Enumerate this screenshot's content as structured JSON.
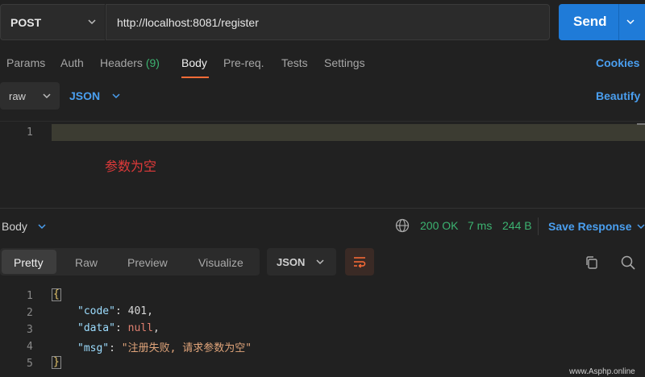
{
  "request": {
    "method": "POST",
    "url": "http://localhost:8081/register",
    "send_label": "Send"
  },
  "request_tabs": {
    "params": "Params",
    "auth": "Auth",
    "headers": "Headers",
    "headers_count": "(9)",
    "body": "Body",
    "prereq": "Pre-req.",
    "tests": "Tests",
    "settings": "Settings",
    "active": "Body",
    "cookies": "Cookies"
  },
  "body_options": {
    "mode": "raw",
    "language": "JSON",
    "beautify": "Beautify"
  },
  "request_editor": {
    "line_numbers": [
      "1"
    ],
    "annotation": "参数为空"
  },
  "response": {
    "body_label": "Body",
    "status": "200 OK",
    "time": "7 ms",
    "size": "244 B",
    "save_response": "Save Response",
    "view_tabs": [
      "Pretty",
      "Raw",
      "Preview",
      "Visualize"
    ],
    "active_view": "Pretty",
    "format": "JSON",
    "line_numbers": [
      "1",
      "2",
      "3",
      "4",
      "5"
    ],
    "open_brace": "{",
    "close_brace": "}",
    "fields": [
      {
        "key": "\"code\"",
        "sep": ": ",
        "value": "401",
        "tail": ","
      },
      {
        "key": "\"data\"",
        "sep": ": ",
        "value": "null",
        "tail": ","
      },
      {
        "key": "\"msg\"",
        "sep": ": ",
        "value": "\"注册失败, 请求参数为空\"",
        "tail": ""
      }
    ]
  },
  "watermark": "www.Asphp.online",
  "colors": {
    "accent_blue": "#1f7bd8",
    "link_blue": "#4a9ff0",
    "status_green": "#3cb371",
    "tab_underline": "#ff6c37",
    "annotation_red": "#e03a3a"
  }
}
